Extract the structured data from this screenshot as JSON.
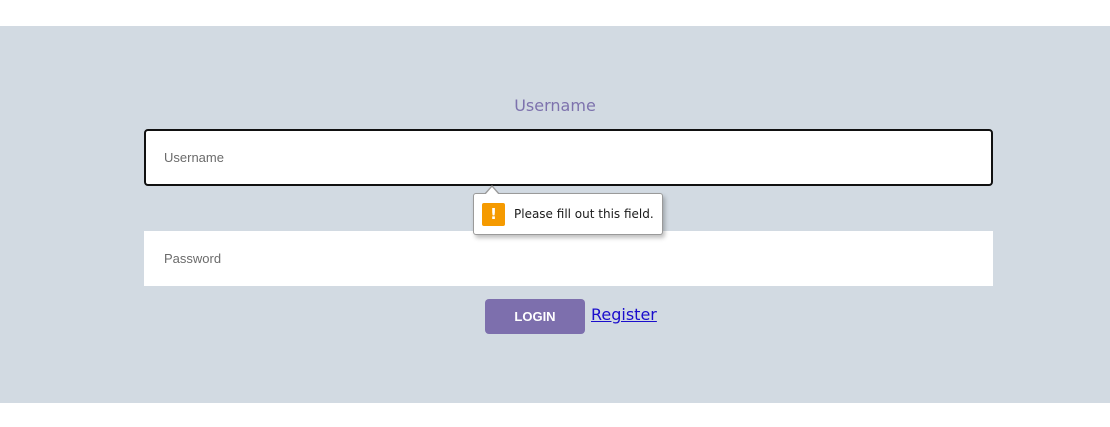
{
  "form": {
    "username_label": "Username",
    "username_placeholder": "Username",
    "password_placeholder": "Password",
    "validation_message": "Please fill out this field.",
    "login_label": "LOGIN",
    "register_label": "Register"
  },
  "icons": {
    "validation": "warning-icon"
  },
  "colors": {
    "band_background": "#d2dae2",
    "accent": "#7d6fad",
    "link": "#1a0dcc",
    "warning": "#f59a00"
  }
}
